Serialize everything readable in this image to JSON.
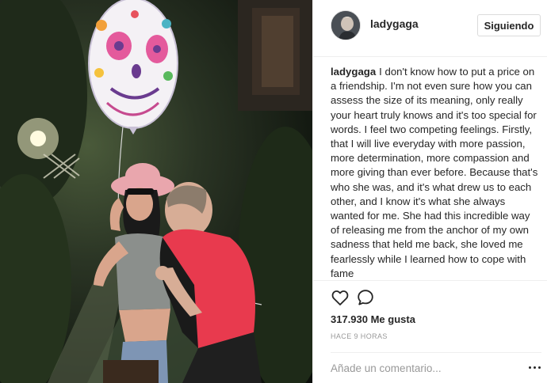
{
  "post": {
    "username": "ladygaga",
    "follow_button": "Siguiendo",
    "caption_user": "ladygaga",
    "caption_text": "I don't know how to put a price on a friendship. I'm not even sure how you can assess the size of its meaning, only really your heart truly knows and it's too special for words. I feel two competing feelings. Firstly, that I will live everyday with more passion, more determination, more compassion and more giving than ever before. Because that's who she was, and it's what drew us to each other, and I know it's what she always wanted for me. She had this incredible way of releasing me from the anchor of my own sadness that held me back, she loved me fearlessly while I learned how to cope with fame",
    "likes": "317.930 Me gusta",
    "time_ago": "HACE 9 HORAS",
    "comment_placeholder": "Añade un comentario..."
  },
  "icons": {
    "like": "heart-icon",
    "comment": "comment-icon",
    "more": "more-options-icon"
  },
  "colors": {
    "text": "#262626",
    "muted": "#999999",
    "border": "#efefef",
    "shirt": "#e83a4e",
    "hat": "#e9a6ad"
  }
}
